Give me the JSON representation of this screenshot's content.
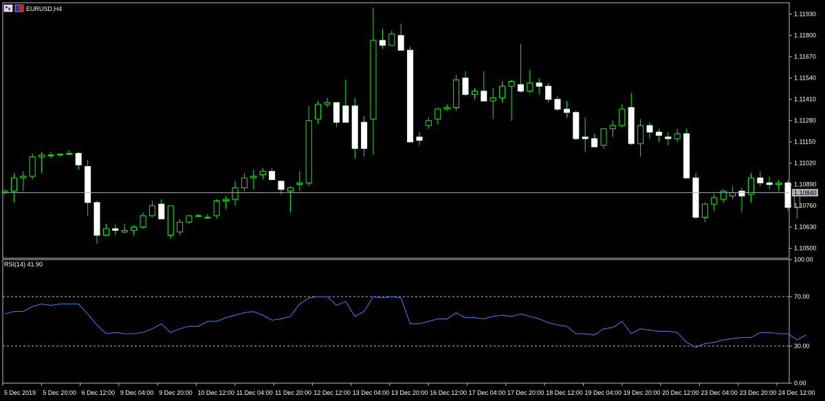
{
  "window": {
    "title": "EURUSD,H4"
  },
  "colors": {
    "background": "#000000",
    "frame": "#c0c0c0",
    "grid": "#c0c0c0",
    "bull_body": "#000000",
    "bull_wick": "#00ff00",
    "bear_body": "#ffffff",
    "bear_wick": "#00ff00",
    "bid_line": "#a9b1b6",
    "rsi_line": "#3a86ff",
    "text": "#ffffff"
  },
  "icons": [
    "chart-window-icon",
    "symbol-flag-icon"
  ],
  "chart_data": [
    {
      "type": "candlestick",
      "title": "EURUSD,H4",
      "current_price": "1.10840",
      "ylim": [
        1.1044,
        1.12
      ],
      "y_ticks": [
        "1.11930",
        "1.11800",
        "1.11670",
        "1.11540",
        "1.11410",
        "1.11280",
        "1.11150",
        "1.11020",
        "1.10890",
        "1.10760",
        "1.10630",
        "1.10500"
      ],
      "x_labels": [
        "5 Dec 2019",
        "5 Dec 20:00",
        "6 Dec 12:00",
        "9 Dec 04:00",
        "9 Dec 20:00",
        "10 Dec 12:00",
        "11 Dec 04:00",
        "11 Dec 20:00",
        "12 Dec 12:00",
        "13 Dec 04:00",
        "13 Dec 20:00",
        "16 Dec 12:00",
        "17 Dec 04:00",
        "17 Dec 20:00",
        "18 Dec 12:00",
        "19 Dec 04:00",
        "19 Dec 20:00",
        "20 Dec 12:00",
        "23 Dec 04:00",
        "23 Dec 20:00",
        "24 Dec 12:00"
      ],
      "candles": [
        [
          1.1084,
          1.1086,
          1.1083,
          1.1085
        ],
        [
          1.1085,
          1.1096,
          1.1078,
          1.1093
        ],
        [
          1.1093,
          1.1097,
          1.1085,
          1.1094
        ],
        [
          1.1094,
          1.1108,
          1.1092,
          1.1106
        ],
        [
          1.1106,
          1.1109,
          1.1096,
          1.1107
        ],
        [
          1.1107,
          1.1109,
          1.1105,
          1.1107
        ],
        [
          1.1107,
          1.1108,
          1.1106,
          1.11075
        ],
        [
          1.1108,
          1.111,
          1.1107,
          1.1108
        ],
        [
          1.1108,
          1.1109,
          1.1098,
          1.1101
        ],
        [
          1.11,
          1.1104,
          1.107,
          1.1078
        ],
        [
          1.1078,
          1.1079,
          1.1053,
          1.1058
        ],
        [
          1.1058,
          1.1065,
          1.1058,
          1.1062
        ],
        [
          1.1062,
          1.1065,
          1.1058,
          1.1061
        ],
        [
          1.106,
          1.1065,
          1.1059,
          1.1061
        ],
        [
          1.1061,
          1.1064,
          1.1058,
          1.1063
        ],
        [
          1.1063,
          1.1072,
          1.1062,
          1.107
        ],
        [
          1.107,
          1.1079,
          1.1069,
          1.1076
        ],
        [
          1.1077,
          1.108,
          1.1068,
          1.1068
        ],
        [
          1.1058,
          1.1076,
          1.1056,
          1.1076
        ],
        [
          1.106,
          1.1068,
          1.1058,
          1.1066
        ],
        [
          1.1066,
          1.107,
          1.1065,
          1.107
        ],
        [
          1.107,
          1.1071,
          1.1069,
          1.107
        ],
        [
          1.1069,
          1.1071,
          1.1068,
          1.1069
        ],
        [
          1.107,
          1.108,
          1.1068,
          1.1079
        ],
        [
          1.1079,
          1.1082,
          1.1074,
          1.108
        ],
        [
          1.108,
          1.1091,
          1.1076,
          1.1087
        ],
        [
          1.1087,
          1.1096,
          1.1085,
          1.1093
        ],
        [
          1.1093,
          1.1098,
          1.1086,
          1.1094
        ],
        [
          1.1095,
          1.1099,
          1.1092,
          1.1097
        ],
        [
          1.1097,
          1.1099,
          1.1092,
          1.1092
        ],
        [
          1.1091,
          1.1091,
          1.1083,
          1.1086
        ],
        [
          1.1085,
          1.1088,
          1.1072,
          1.1087
        ],
        [
          1.1089,
          1.1097,
          1.1085,
          1.109
        ],
        [
          1.109,
          1.1137,
          1.1088,
          1.1128
        ],
        [
          1.1129,
          1.114,
          1.1126,
          1.1138
        ],
        [
          1.1138,
          1.1142,
          1.1136,
          1.1139
        ],
        [
          1.1139,
          1.1139,
          1.1124,
          1.1127
        ],
        [
          1.1137,
          1.1153,
          1.1132,
          1.1127
        ],
        [
          1.1137,
          1.1142,
          1.1105,
          1.1111
        ],
        [
          1.1127,
          1.1131,
          1.1106,
          1.1111
        ],
        [
          1.1129,
          1.1197,
          1.1107,
          1.1177
        ],
        [
          1.1177,
          1.1184,
          1.1172,
          1.1174
        ],
        [
          1.1174,
          1.1183,
          1.1174,
          1.1181
        ],
        [
          1.118,
          1.1187,
          1.1171,
          1.1171
        ],
        [
          1.1171,
          1.1173,
          1.1115,
          1.1115
        ],
        [
          1.1118,
          1.1121,
          1.1113,
          1.1116
        ],
        [
          1.1125,
          1.113,
          1.1123,
          1.1128
        ],
        [
          1.1129,
          1.1136,
          1.1126,
          1.1135
        ],
        [
          1.1135,
          1.1138,
          1.1134,
          1.1136
        ],
        [
          1.1136,
          1.1156,
          1.1134,
          1.1153
        ],
        [
          1.1154,
          1.1158,
          1.1143,
          1.1144
        ],
        [
          1.1144,
          1.1148,
          1.1141,
          1.1146
        ],
        [
          1.1146,
          1.1158,
          1.114,
          1.114
        ],
        [
          1.114,
          1.1148,
          1.1129,
          1.1142
        ],
        [
          1.1142,
          1.1152,
          1.1139,
          1.1149
        ],
        [
          1.1149,
          1.1153,
          1.1128,
          1.1152
        ],
        [
          1.115,
          1.1175,
          1.1145,
          1.1146
        ],
        [
          1.1146,
          1.1159,
          1.1145,
          1.1151
        ],
        [
          1.1151,
          1.1154,
          1.1144,
          1.1149
        ],
        [
          1.1149,
          1.1151,
          1.1139,
          1.1141
        ],
        [
          1.1141,
          1.1143,
          1.1134,
          1.1135
        ],
        [
          1.1135,
          1.114,
          1.113,
          1.1133
        ],
        [
          1.1133,
          1.1134,
          1.1116,
          1.1117
        ],
        [
          1.1118,
          1.113,
          1.1109,
          1.1117
        ],
        [
          1.1117,
          1.112,
          1.1113,
          1.1112
        ],
        [
          1.1113,
          1.1123,
          1.1111,
          1.1123
        ],
        [
          1.1123,
          1.1128,
          1.1118,
          1.1125
        ],
        [
          1.1125,
          1.1138,
          1.1124,
          1.1135
        ],
        [
          1.1136,
          1.1145,
          1.1113,
          1.1114
        ],
        [
          1.1114,
          1.1129,
          1.1106,
          1.1125
        ],
        [
          1.1125,
          1.1127,
          1.1117,
          1.1121
        ],
        [
          1.1121,
          1.1123,
          1.1115,
          1.1119
        ],
        [
          1.1118,
          1.1121,
          1.1113,
          1.1117
        ],
        [
          1.1117,
          1.1123,
          1.1115,
          1.112
        ],
        [
          1.112,
          1.1123,
          1.1119,
          1.1093
        ],
        [
          1.1093,
          1.1096,
          1.1068,
          1.1069
        ],
        [
          1.1069,
          1.1078,
          1.1066,
          1.1077
        ],
        [
          1.1077,
          1.1083,
          1.1073,
          1.1081
        ],
        [
          1.108,
          1.1086,
          1.1078,
          1.1085
        ],
        [
          1.1082,
          1.1088,
          1.108,
          1.1084
        ],
        [
          1.1085,
          1.1087,
          1.1072,
          1.1082
        ],
        [
          1.1083,
          1.1096,
          1.1078,
          1.1093
        ],
        [
          1.1093,
          1.1097,
          1.1088,
          1.109
        ],
        [
          1.109,
          1.1094,
          1.1086,
          1.1089
        ],
        [
          1.1089,
          1.1092,
          1.1085,
          1.109
        ],
        [
          1.109,
          1.1092,
          1.1073,
          1.1075
        ],
        [
          1.1075,
          1.1086,
          1.1068,
          1.1083
        ]
      ]
    },
    {
      "type": "line",
      "title": "RSI(14) 41.90",
      "ylim": [
        0,
        100
      ],
      "y_ticks": [
        "100.00",
        "70.00",
        "30.00",
        "0.00"
      ],
      "levels": [
        70,
        30
      ],
      "values": [
        56,
        58,
        58,
        62,
        64,
        63,
        64,
        64,
        64,
        56,
        47,
        40,
        41,
        40,
        40,
        41,
        44,
        48,
        41,
        44,
        46,
        46,
        50,
        50,
        53,
        55,
        57,
        58,
        55,
        51,
        52,
        54,
        64,
        69,
        70,
        70,
        63,
        66,
        54,
        58,
        70,
        69,
        70,
        69,
        48,
        48,
        50,
        52,
        52,
        57,
        53,
        53,
        52,
        54,
        55,
        54,
        56,
        54,
        52,
        49,
        47,
        46,
        40,
        40,
        39,
        44,
        45,
        50,
        40,
        44,
        43,
        42,
        42,
        41,
        33,
        29,
        32,
        33,
        35,
        36,
        37,
        37,
        41,
        41,
        40,
        40,
        35,
        39
      ]
    }
  ]
}
